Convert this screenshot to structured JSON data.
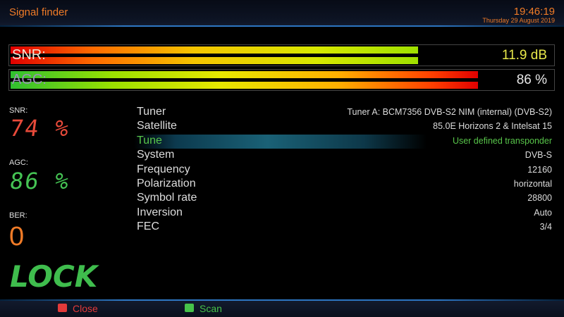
{
  "header": {
    "title": "Signal finder",
    "time": "19:46:19",
    "date": "Thursday 29 August 2019"
  },
  "meters": {
    "snr": {
      "label": "SNR:",
      "value": "11.9 dB",
      "level": 0.75,
      "value_color": "#e8e84a"
    },
    "agc": {
      "label": "AGC:",
      "value": "86 %",
      "level": 0.86,
      "value_color": "#e8e8e8"
    }
  },
  "stats": {
    "snr_label": "SNR:",
    "snr_value": "74 %",
    "snr_color": "#e84a3a",
    "agc_label": "AGC:",
    "agc_value": "86 %",
    "agc_color": "#45c454",
    "ber_label": "BER:",
    "ber_value": "0",
    "lock_text": "LOCK"
  },
  "info": [
    {
      "key": "Tuner",
      "value": "Tuner A: BCM7356 DVB-S2 NIM (internal) (DVB-S2)"
    },
    {
      "key": "Satellite",
      "value": "85.0E Horizons 2 & Intelsat 15"
    },
    {
      "key": "Tune",
      "value": "User defined transponder",
      "selected": true
    },
    {
      "key": "System",
      "value": "DVB-S"
    },
    {
      "key": "Frequency",
      "value": "12160"
    },
    {
      "key": "Polarization",
      "value": "horizontal"
    },
    {
      "key": "Symbol rate",
      "value": "28800"
    },
    {
      "key": "Inversion",
      "value": "Auto"
    },
    {
      "key": "FEC",
      "value": "3/4"
    }
  ],
  "footer": {
    "close_label": "Close",
    "close_color": "#e23a3a",
    "scan_label": "Scan",
    "scan_color": "#46c24a"
  }
}
